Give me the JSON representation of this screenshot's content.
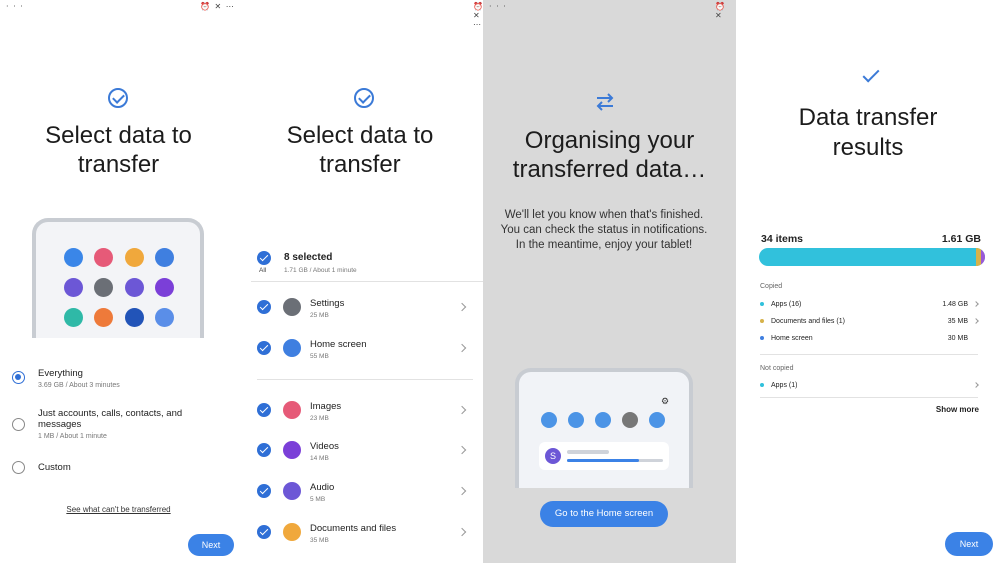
{
  "panel1": {
    "status_left": "· · ·",
    "status_right": "⏰ ✕ ⋯",
    "title_line1": "Select data to",
    "title_line2": "transfer",
    "options": [
      {
        "label": "Everything",
        "sub": "3.69 GB / About 3 minutes",
        "selected": true
      },
      {
        "label": "Just accounts, calls, contacts, and messages",
        "sub": "1 MB / About 1 minute",
        "selected": false
      },
      {
        "label": "Custom",
        "sub": "",
        "selected": false
      }
    ],
    "link": "See what can't be transferred",
    "next_label": "Next"
  },
  "panel2": {
    "status_right": "⏰ ✕ ⋯",
    "title_line1": "Select data to",
    "title_line2": "transfer",
    "all_label": "All",
    "selected_count": "8 selected",
    "selected_sub": "1.71 GB / About 1 minute",
    "items": [
      {
        "label": "Settings",
        "sub": "25 MB",
        "color": "#6b6f76"
      },
      {
        "label": "Home screen",
        "sub": "55 MB",
        "color": "#3f7fe0"
      },
      {
        "label": "Images",
        "sub": "23 MB",
        "color": "#e65a78"
      },
      {
        "label": "Videos",
        "sub": "14 MB",
        "color": "#7b3fd8"
      },
      {
        "label": "Audio",
        "sub": "5 MB",
        "color": "#6c57d6"
      },
      {
        "label": "Documents and files",
        "sub": "35 MB",
        "color": "#f0a83c"
      }
    ]
  },
  "panel3": {
    "status_left": "· · ·",
    "status_right": "⏰ ✕",
    "title_line1": "Organising your",
    "title_line2": "transferred data…",
    "body": "We'll let you know when that's finished. You can check the status in notifications. In the meantime, enjoy your tablet!",
    "button": "Go to the Home screen",
    "notif_progress": 0.75
  },
  "panel4": {
    "title_line1": "Data transfer",
    "title_line2": "results",
    "items_count": "34 items",
    "total_size": "1.61 GB",
    "copied_label": "Copied",
    "copied": [
      {
        "label": "Apps (16)",
        "size": "1.48 GB",
        "color": "#31c1dc"
      },
      {
        "label": "Documents and files (1)",
        "size": "35 MB",
        "color": "#d6b24a"
      },
      {
        "label": "Home screen",
        "size": "30 MB",
        "color": "#3f7fe0"
      }
    ],
    "not_copied_label": "Not copied",
    "not_copied": [
      {
        "label": "Apps (1)",
        "color": "#31c1dc"
      }
    ],
    "show_more": "Show more",
    "next_label": "Next"
  },
  "colors": {
    "accent": "#3b82e6",
    "check": "#3b7ad7",
    "bar": "#31c1dc"
  }
}
